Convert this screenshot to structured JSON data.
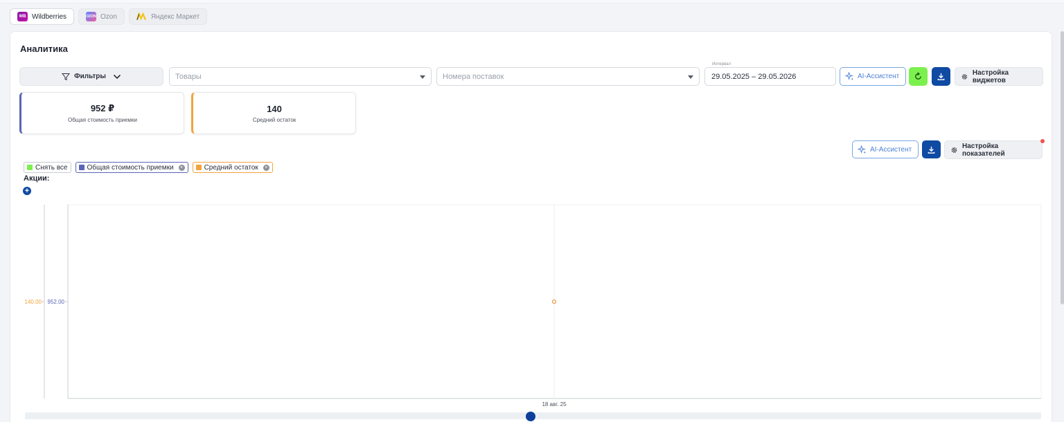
{
  "marketplaces": [
    {
      "label": "Wildberries",
      "logo_text": "WB",
      "active": true
    },
    {
      "label": "Ozon",
      "logo_text": "OZON",
      "active": false
    },
    {
      "label": "Яндекс Маркет",
      "logo_text": "M",
      "active": false
    }
  ],
  "page": {
    "title": "Аналитика"
  },
  "toolbar": {
    "filters_label": "Фильтры",
    "products_placeholder": "Товары",
    "shipments_placeholder": "Номера поставок",
    "date_caption": "Интервал",
    "date_range": "29.05.2025 – 29.05.2026",
    "ai_label": "AI-Ассистент",
    "widgets_settings_label": "Настройка виджетов"
  },
  "kpis": [
    {
      "value": "952 ₽",
      "label": "Общая стоимость приемки",
      "color": "#5a64b8"
    },
    {
      "value": "140",
      "label": "Средний остаток",
      "color": "#f3a33d"
    }
  ],
  "chart_toolbar": {
    "ai_label": "AI-Ассистент",
    "metrics_settings_label": "Настройка показателей"
  },
  "legend_chips": [
    {
      "label": "Снять все",
      "color": "#7cf04d",
      "removable": false
    },
    {
      "label": "Общая стоимость приемки",
      "color": "#5a64b8",
      "removable": true
    },
    {
      "label": "Средний остаток",
      "color": "#f3a33d",
      "removable": true
    }
  ],
  "promos": {
    "label": "Акции:"
  },
  "chart_data": {
    "type": "line",
    "x": [
      "18 авг. 25"
    ],
    "series": [
      {
        "name": "Общая стоимость приемки",
        "values": [
          952.0
        ],
        "color": "#5a64b8"
      },
      {
        "name": "Средний остаток",
        "values": [
          140.0
        ],
        "color": "#f3a33d"
      }
    ],
    "y_tick_labels": [
      "140.00",
      "952.00"
    ],
    "x_tick_labels": [
      "18 авг. 25"
    ],
    "grid": true
  }
}
